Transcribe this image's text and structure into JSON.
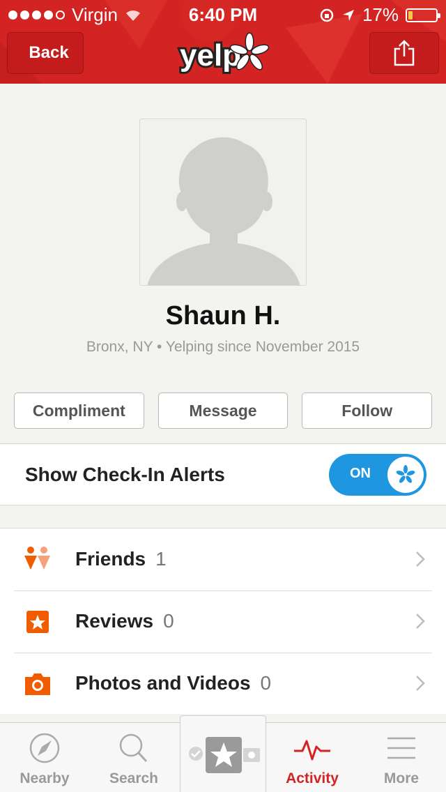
{
  "status_bar": {
    "carrier": "Virgin",
    "time": "6:40 PM",
    "battery_percent": "17%",
    "battery_level": 0.17,
    "signal_bars_filled": 4,
    "signal_bars_total": 5
  },
  "header": {
    "back_label": "Back",
    "logo_text": "yelp",
    "share_icon": "share-icon"
  },
  "profile": {
    "name": "Shaun H.",
    "location": "Bronx, NY",
    "separator": "•",
    "since": "Yelping since November 2015"
  },
  "actions": {
    "compliment": "Compliment",
    "message": "Message",
    "follow": "Follow"
  },
  "checkin": {
    "label": "Show Check-In Alerts",
    "toggle_text": "ON",
    "toggle_on": true
  },
  "list": [
    {
      "label": "Friends",
      "count": "1",
      "icon": "friends-icon"
    },
    {
      "label": "Reviews",
      "count": "0",
      "icon": "review-star-icon"
    },
    {
      "label": "Photos and Videos",
      "count": "0",
      "icon": "camera-icon"
    }
  ],
  "tabs": {
    "nearby": "Nearby",
    "search": "Search",
    "activity": "Activity",
    "more": "More"
  },
  "colors": {
    "brand_red": "#d32323",
    "toggle_blue": "#1e96e0",
    "icon_orange": "#f15c00"
  }
}
